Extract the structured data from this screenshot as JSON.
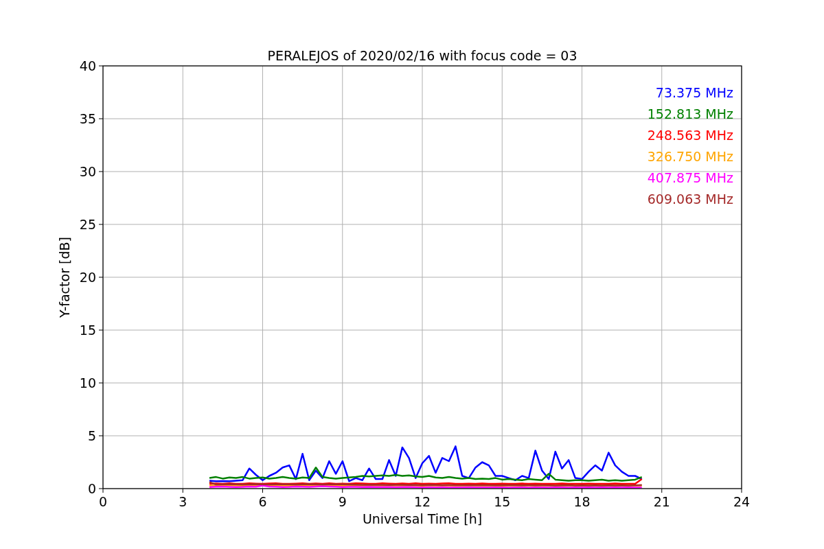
{
  "chart_data": {
    "type": "line",
    "title": "PERALEJOS of 2020/02/16 with focus code = 03",
    "xlabel": "Universal Time [h]",
    "ylabel": "Y-factor [dB]",
    "xlim": [
      0,
      24
    ],
    "ylim": [
      0,
      40
    ],
    "xticks": [
      0,
      3,
      6,
      9,
      12,
      15,
      18,
      21,
      24
    ],
    "yticks": [
      0,
      5,
      10,
      15,
      20,
      25,
      30,
      35,
      40
    ],
    "grid": true,
    "x": [
      4,
      4.25,
      4.5,
      4.75,
      5,
      5.25,
      5.5,
      5.75,
      6,
      6.25,
      6.5,
      6.75,
      7,
      7.25,
      7.5,
      7.75,
      8,
      8.25,
      8.5,
      8.75,
      9,
      9.25,
      9.5,
      9.75,
      10,
      10.25,
      10.5,
      10.75,
      11,
      11.25,
      11.5,
      11.75,
      12,
      12.25,
      12.5,
      12.75,
      13,
      13.25,
      13.5,
      13.75,
      14,
      14.25,
      14.5,
      14.75,
      15,
      15.25,
      15.5,
      15.75,
      16,
      16.25,
      16.5,
      16.75,
      17,
      17.25,
      17.5,
      17.75,
      18,
      18.25,
      18.5,
      18.75,
      19,
      19.25,
      19.5,
      19.75,
      20,
      20.25
    ],
    "series": [
      {
        "name": "73.375 MHz",
        "color": "#0000ff",
        "values": [
          0.75,
          0.7,
          0.72,
          0.7,
          0.75,
          0.8,
          1.9,
          1.3,
          0.8,
          1.2,
          1.5,
          2.0,
          2.2,
          0.9,
          3.3,
          0.8,
          1.7,
          1.0,
          2.6,
          1.4,
          2.6,
          0.7,
          1.0,
          0.8,
          1.9,
          0.9,
          0.9,
          2.7,
          1.2,
          3.9,
          2.9,
          1.0,
          2.4,
          3.1,
          1.5,
          2.9,
          2.6,
          4.0,
          1.2,
          1.0,
          2.0,
          2.5,
          2.2,
          1.2,
          1.2,
          1.0,
          0.8,
          1.2,
          1.0,
          3.6,
          1.7,
          0.9,
          3.5,
          1.9,
          2.7,
          1.0,
          0.9,
          1.6,
          2.2,
          1.7,
          3.4,
          2.2,
          1.6,
          1.2,
          1.2,
          0.9
        ]
      },
      {
        "name": "152.813 MHz",
        "color": "#008000",
        "values": [
          1.0,
          1.1,
          0.95,
          1.05,
          1.0,
          1.1,
          0.95,
          1.0,
          1.05,
          0.95,
          1.0,
          1.1,
          1.0,
          0.95,
          1.05,
          1.0,
          2.0,
          1.1,
          1.0,
          0.95,
          1.0,
          1.05,
          1.1,
          1.2,
          1.15,
          1.2,
          1.25,
          1.2,
          1.3,
          1.2,
          1.25,
          1.15,
          1.1,
          1.2,
          1.05,
          1.0,
          1.1,
          1.0,
          0.95,
          1.0,
          0.9,
          0.95,
          0.9,
          1.0,
          0.85,
          0.9,
          0.85,
          0.8,
          0.9,
          0.85,
          0.8,
          1.4,
          0.85,
          0.8,
          0.75,
          0.8,
          0.8,
          0.75,
          0.8,
          0.85,
          0.75,
          0.8,
          0.75,
          0.8,
          0.85,
          1.1
        ]
      },
      {
        "name": "248.563 MHz",
        "color": "#ff0000",
        "values": [
          0.45,
          0.48,
          0.45,
          0.5,
          0.46,
          0.45,
          0.5,
          0.47,
          0.45,
          0.48,
          0.5,
          0.46,
          0.45,
          0.47,
          0.5,
          0.45,
          0.48,
          0.46,
          0.5,
          0.45,
          0.47,
          0.45,
          0.5,
          0.48,
          0.46,
          0.45,
          0.5,
          0.47,
          0.45,
          0.48,
          0.46,
          0.5,
          0.45,
          0.47,
          0.45,
          0.48,
          0.5,
          0.46,
          0.45,
          0.47,
          0.45,
          0.48,
          0.46,
          0.45,
          0.47,
          0.45,
          0.46,
          0.48,
          0.45,
          0.47,
          0.45,
          0.46,
          0.45,
          0.48,
          0.45,
          0.46,
          0.45,
          0.47,
          0.45,
          0.46,
          0.45,
          0.48,
          0.45,
          0.46,
          0.45,
          0.9
        ]
      },
      {
        "name": "326.750 MHz",
        "color": "#ffa500",
        "values": [
          0.3,
          0.28,
          0.3,
          0.32,
          0.3,
          0.28,
          0.3,
          0.3,
          0.29,
          0.3,
          0.31,
          0.3,
          0.28,
          0.3,
          0.3,
          0.29,
          0.3,
          0.3,
          0.31,
          0.3,
          0.28,
          0.3,
          0.3,
          0.29,
          0.3,
          0.3,
          0.3,
          0.31,
          0.3,
          0.29,
          0.3,
          0.3,
          0.28,
          0.3,
          0.3,
          0.29,
          0.3,
          0.3,
          0.31,
          0.3,
          0.3,
          0.29,
          0.3,
          0.3,
          0.28,
          0.3,
          0.3,
          0.29,
          0.3,
          0.3,
          0.3,
          0.31,
          0.3,
          0.29,
          0.3,
          0.3,
          0.28,
          0.3,
          0.3,
          0.29,
          0.3,
          0.3,
          0.3,
          0.29,
          0.3,
          0.3
        ]
      },
      {
        "name": "407.875 MHz",
        "color": "#ff00ff",
        "values": [
          0.15,
          0.18,
          0.2,
          0.17,
          0.15,
          0.16,
          0.2,
          0.18,
          0.3,
          0.2,
          0.18,
          0.15,
          0.16,
          0.2,
          0.18,
          0.17,
          0.2,
          0.22,
          0.2,
          0.18,
          0.15,
          0.16,
          0.17,
          0.15,
          0.16,
          0.15,
          0.14,
          0.15,
          0.13,
          0.15,
          0.14,
          0.13,
          0.12,
          0.13,
          0.12,
          0.13,
          0.12,
          0.11,
          0.12,
          0.13,
          0.12,
          0.11,
          0.12,
          0.11,
          0.12,
          0.1,
          0.12,
          0.11,
          0.1,
          0.12,
          0.11,
          0.1,
          0.11,
          0.12,
          0.1,
          0.11,
          0.1,
          0.11,
          0.1,
          0.12,
          0.1,
          0.11,
          0.1,
          0.11,
          0.1,
          0.12
        ]
      },
      {
        "name": "609.063 MHz",
        "color": "#a52a2a",
        "values": [
          0.62,
          0.38,
          0.4,
          0.42,
          0.4,
          0.38,
          0.4,
          0.42,
          0.4,
          0.38,
          0.4,
          0.41,
          0.4,
          0.38,
          0.4,
          0.42,
          0.4,
          0.39,
          0.4,
          0.41,
          0.4,
          0.38,
          0.37,
          0.36,
          0.35,
          0.36,
          0.35,
          0.34,
          0.35,
          0.36,
          0.34,
          0.35,
          0.33,
          0.35,
          0.34,
          0.33,
          0.34,
          0.33,
          0.32,
          0.33,
          0.32,
          0.33,
          0.32,
          0.31,
          0.32,
          0.33,
          0.32,
          0.31,
          0.32,
          0.31,
          0.32,
          0.31,
          0.3,
          0.31,
          0.32,
          0.3,
          0.31,
          0.3,
          0.31,
          0.3,
          0.31,
          0.3,
          0.31,
          0.3,
          0.31,
          0.34
        ]
      }
    ]
  }
}
